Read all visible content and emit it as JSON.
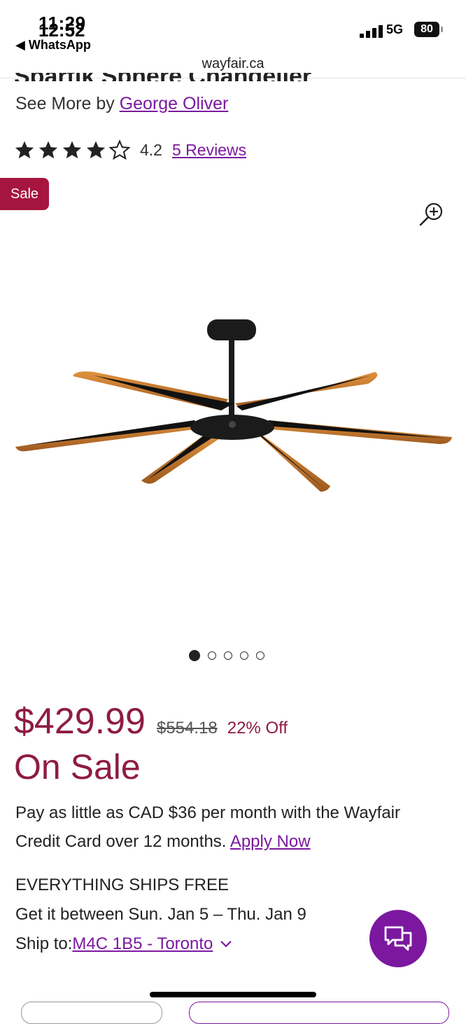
{
  "status_bar": {
    "time": "11:29",
    "time_ghost": "12:52",
    "back_app": "◀ WhatsApp",
    "network": "5G",
    "battery": "80"
  },
  "browser": {
    "url": "wayfair.ca"
  },
  "product": {
    "title_cut": "Spartik Sphere Chandelier",
    "see_more_prefix": "See More by ",
    "brand": "George Oliver",
    "rating": "4.2",
    "rating_stars": 4,
    "reviews_link": "5 Reviews",
    "sale_badge": "Sale"
  },
  "gallery": {
    "total": 5,
    "active": 1
  },
  "pricing": {
    "price": "$429.99",
    "old_price": "$554.18",
    "discount": "22% Off",
    "on_sale": "On Sale",
    "credit_text": "Pay as little as CAD $36 per month with the Wayfair Credit Card over 12 months. ",
    "apply_link": "Apply Now"
  },
  "shipping": {
    "ships_free": "EVERYTHING SHIPS FREE",
    "delivery": "Get it between Sun. Jan 5 – Thu. Jan 9",
    "ship_to_label": "Ship to: ",
    "location": "M4C 1B5 - Toronto"
  },
  "colors": {
    "accent": "#7b189f",
    "sale": "#a6153f",
    "price": "#8e1c40"
  },
  "icons": [
    "star-icon",
    "magnify-plus-icon",
    "chevron-down-icon",
    "chat-icon",
    "signal-icon",
    "battery-icon"
  ]
}
